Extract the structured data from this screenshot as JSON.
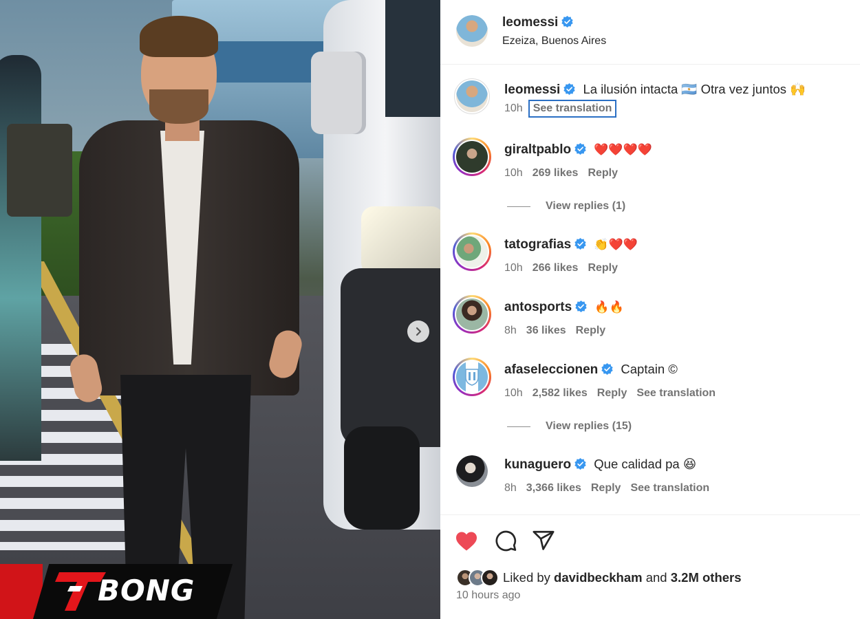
{
  "post": {
    "author": "leomessi",
    "location": "Ezeiza, Buenos Aires",
    "caption": {
      "username": "leomessi",
      "text": "La ilusión intacta 🇦🇷 Otra vez juntos 🙌",
      "time": "10h",
      "see_translation": "See translation"
    }
  },
  "comments": [
    {
      "username": "giraltpablo",
      "text": "❤️❤️❤️❤️",
      "time": "10h",
      "likes": "269 likes",
      "reply": "Reply",
      "view_replies": "View replies (1)"
    },
    {
      "username": "tatografias",
      "text": "👏❤️❤️",
      "time": "10h",
      "likes": "266 likes",
      "reply": "Reply"
    },
    {
      "username": "antosports",
      "text": "🔥🔥",
      "time": "8h",
      "likes": "36 likes",
      "reply": "Reply"
    },
    {
      "username": "afaseleccionen",
      "text": "Captain ©",
      "time": "10h",
      "likes": "2,582 likes",
      "reply": "Reply",
      "see_translation": "See translation",
      "view_replies": "View replies (15)"
    },
    {
      "username": "kunaguero",
      "text": "Que calidad pa 😆",
      "time": "8h",
      "likes": "3,366 likes",
      "reply": "Reply",
      "see_translation": "See translation"
    }
  ],
  "footer": {
    "liked_by_prefix": "Liked by",
    "liked_by_user": "davidbeckham",
    "liked_by_and": "and",
    "liked_by_others": "3.2M others",
    "time_ago": "10 hours ago"
  },
  "icons": {
    "like": "heart-icon",
    "comment": "comment-bubble-icon",
    "share": "share-send-icon",
    "verified": "verified-badge-icon",
    "next": "chevron-right-icon"
  },
  "watermark": {
    "text": "BONG"
  },
  "colors": {
    "verified": "#3897f0",
    "heart": "#ed4956",
    "brand_red": "#d11418"
  }
}
